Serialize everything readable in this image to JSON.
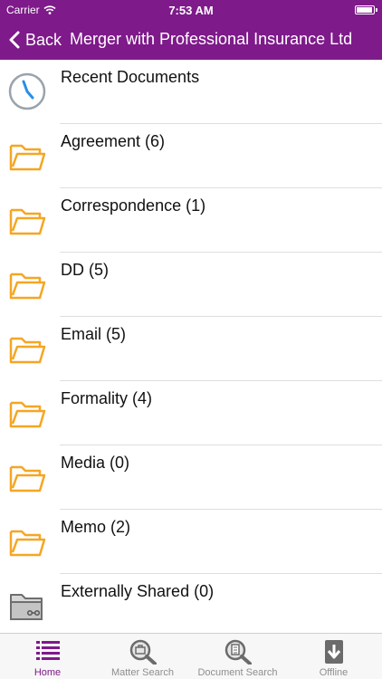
{
  "status": {
    "carrier": "Carrier",
    "time": "7:53 AM"
  },
  "nav": {
    "back_label": "Back",
    "title": "Merger with Professional Insurance Ltd"
  },
  "items": [
    {
      "label": "Recent Documents",
      "icon": "clock-icon"
    },
    {
      "label": "Agreement (6)",
      "icon": "folder-icon"
    },
    {
      "label": "Correspondence (1)",
      "icon": "folder-icon"
    },
    {
      "label": "DD (5)",
      "icon": "folder-icon"
    },
    {
      "label": "Email (5)",
      "icon": "folder-icon"
    },
    {
      "label": "Formality (4)",
      "icon": "folder-icon"
    },
    {
      "label": "Media (0)",
      "icon": "folder-icon"
    },
    {
      "label": "Memo (2)",
      "icon": "folder-icon"
    },
    {
      "label": "Externally Shared (0)",
      "icon": "shared-folder-icon"
    }
  ],
  "tabs": [
    {
      "label": "Home",
      "icon": "list-icon",
      "active": true
    },
    {
      "label": "Matter Search",
      "icon": "matter-search-icon",
      "active": false
    },
    {
      "label": "Document Search",
      "icon": "document-search-icon",
      "active": false
    },
    {
      "label": "Offline",
      "icon": "download-icon",
      "active": false
    }
  ],
  "colors": {
    "brand": "#7e1a8a",
    "folder": "#f5a623",
    "clock": "#2a8ee8"
  }
}
